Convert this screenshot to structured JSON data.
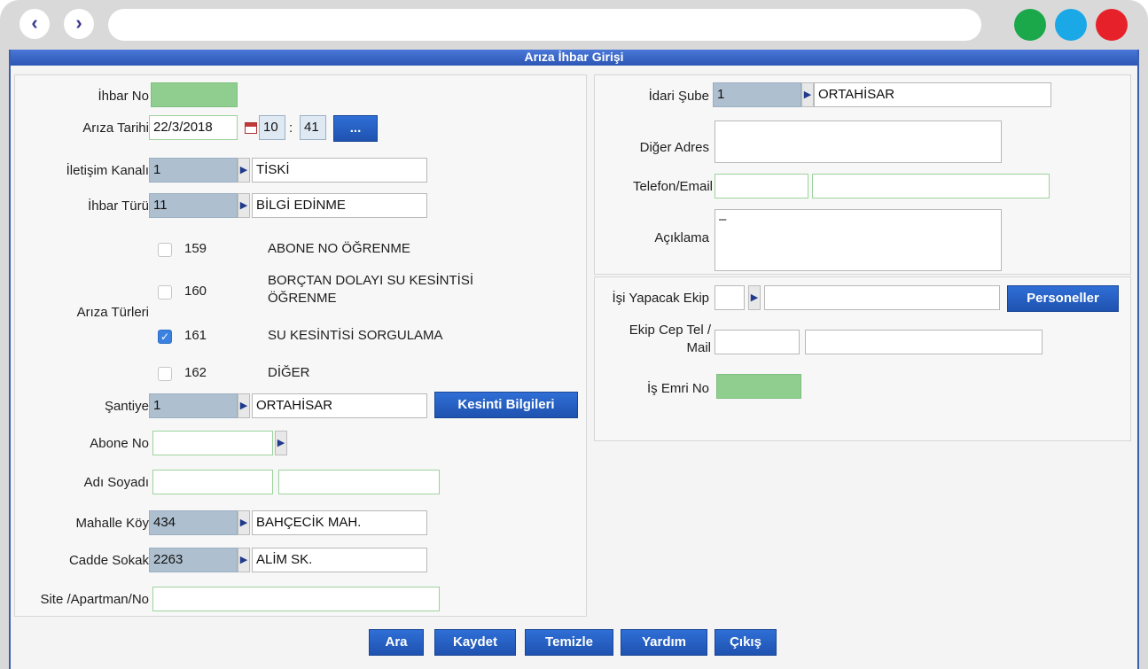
{
  "window_title": "Arıza İhbar Girişi",
  "left": {
    "ihbar_no": {
      "label": "İhbar No",
      "value": ""
    },
    "ariza_tarihi": {
      "label": "Arıza Tarihi",
      "date": "22/3/2018",
      "hour": "10",
      "minute": "41",
      "sep": ":",
      "more_label": "..."
    },
    "iletisim_kanali": {
      "label": "İletişim Kanalı",
      "code": "1",
      "name": "TİSKİ"
    },
    "ihbar_turu": {
      "label": "İhbar Türü",
      "code": "11",
      "name": "BİLGİ EDİNME"
    },
    "ariza_turleri": {
      "label": "Arıza Türleri",
      "items": [
        {
          "code": "159",
          "text": "ABONE NO ÖĞRENME",
          "checked": false
        },
        {
          "code": "160",
          "text": "BORÇTAN DOLAYI SU KESİNTİSİ",
          "text2": "ÖĞRENME",
          "checked": false
        },
        {
          "code": "161",
          "text": "SU KESİNTİSİ SORGULAMA",
          "checked": true
        },
        {
          "code": "162",
          "text": "DİĞER",
          "checked": false
        }
      ]
    },
    "santiye": {
      "label": "Şantiye",
      "code": "1",
      "name": "ORTAHİSAR",
      "button": "Kesinti Bilgileri"
    },
    "abone_no": {
      "label": "Abone No",
      "value": ""
    },
    "adi_soyadi": {
      "label": "Adı Soyadı",
      "first": "",
      "last": ""
    },
    "mahalle_koy": {
      "label": "Mahalle Köy",
      "code": "434",
      "name": "BAHÇECİK MAH."
    },
    "cadde_sokak": {
      "label": "Cadde Sokak",
      "code": "2263",
      "name": "ALİM SK."
    },
    "site_apartman": {
      "label": "Site /Apartman/No",
      "value": ""
    }
  },
  "right": {
    "idari_sube": {
      "label": "İdari Şube",
      "code": "1",
      "name": "ORTAHİSAR"
    },
    "diger_adres": {
      "label": "Diğer Adres",
      "value": ""
    },
    "telefon_email": {
      "label": "Telefon/Email",
      "phone": "",
      "email": ""
    },
    "aciklama": {
      "label": "Açıklama",
      "value": "–"
    },
    "isi_yapacak_ekip": {
      "label": "İşi Yapacak Ekip",
      "code": "",
      "name": "",
      "button": "Personeller"
    },
    "ekip_cep_tel": {
      "label1": "Ekip Cep Tel /",
      "label2": "Mail",
      "phone": "",
      "mail": ""
    },
    "is_emri_no": {
      "label": "İş Emri No",
      "value": ""
    }
  },
  "footer_buttons": {
    "ara": "Ara",
    "kaydet": "Kaydet",
    "temizle": "Temizle",
    "yardim": "Yardım",
    "cikis": "Çıkış"
  },
  "chrome": {
    "back": "‹",
    "forward": "›",
    "url": ""
  },
  "colors": {
    "green_dot": "#1aa84a",
    "blue_dot": "#1aa8e6",
    "red_dot": "#e6212a",
    "accent": "#2c56b4"
  }
}
